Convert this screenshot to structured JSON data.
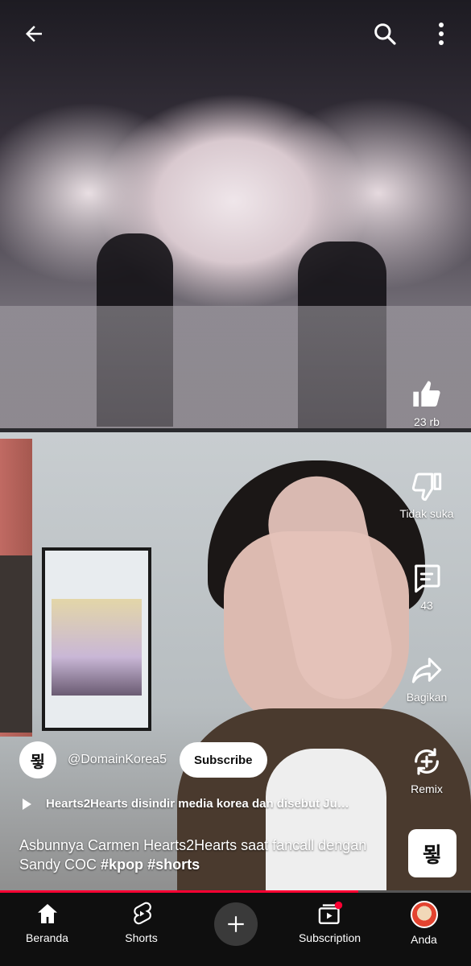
{
  "actions": {
    "like": {
      "label": "23 rb",
      "icon": "thumb-up-icon"
    },
    "dislike": {
      "label": "Tidak suka",
      "icon": "thumb-down-icon"
    },
    "comments": {
      "label": "43",
      "icon": "comment-icon"
    },
    "share": {
      "label": "Bagikan",
      "icon": "share-icon"
    },
    "remix": {
      "label": "Remix",
      "icon": "remix-icon"
    }
  },
  "channel": {
    "handle": "@DomainKorea5",
    "avatar_text": "묗",
    "subscribe_label": "Subscribe"
  },
  "sound": {
    "title": "Hearts2Hearts disindir media korea dan disebut Ju…",
    "thumb_text": "묗"
  },
  "caption": {
    "text": "Asbunnya Carmen Hearts2Hearts saat fancall dengan Sandy COC ",
    "tags": [
      "#kpop",
      "#shorts"
    ]
  },
  "progress": 0.76,
  "nav": {
    "home": "Beranda",
    "shorts": "Shorts",
    "subscriptions": "Subscription",
    "you": "Anda"
  },
  "colors": {
    "accent": "#ff0033",
    "nav_bg": "#0f0f0f"
  }
}
